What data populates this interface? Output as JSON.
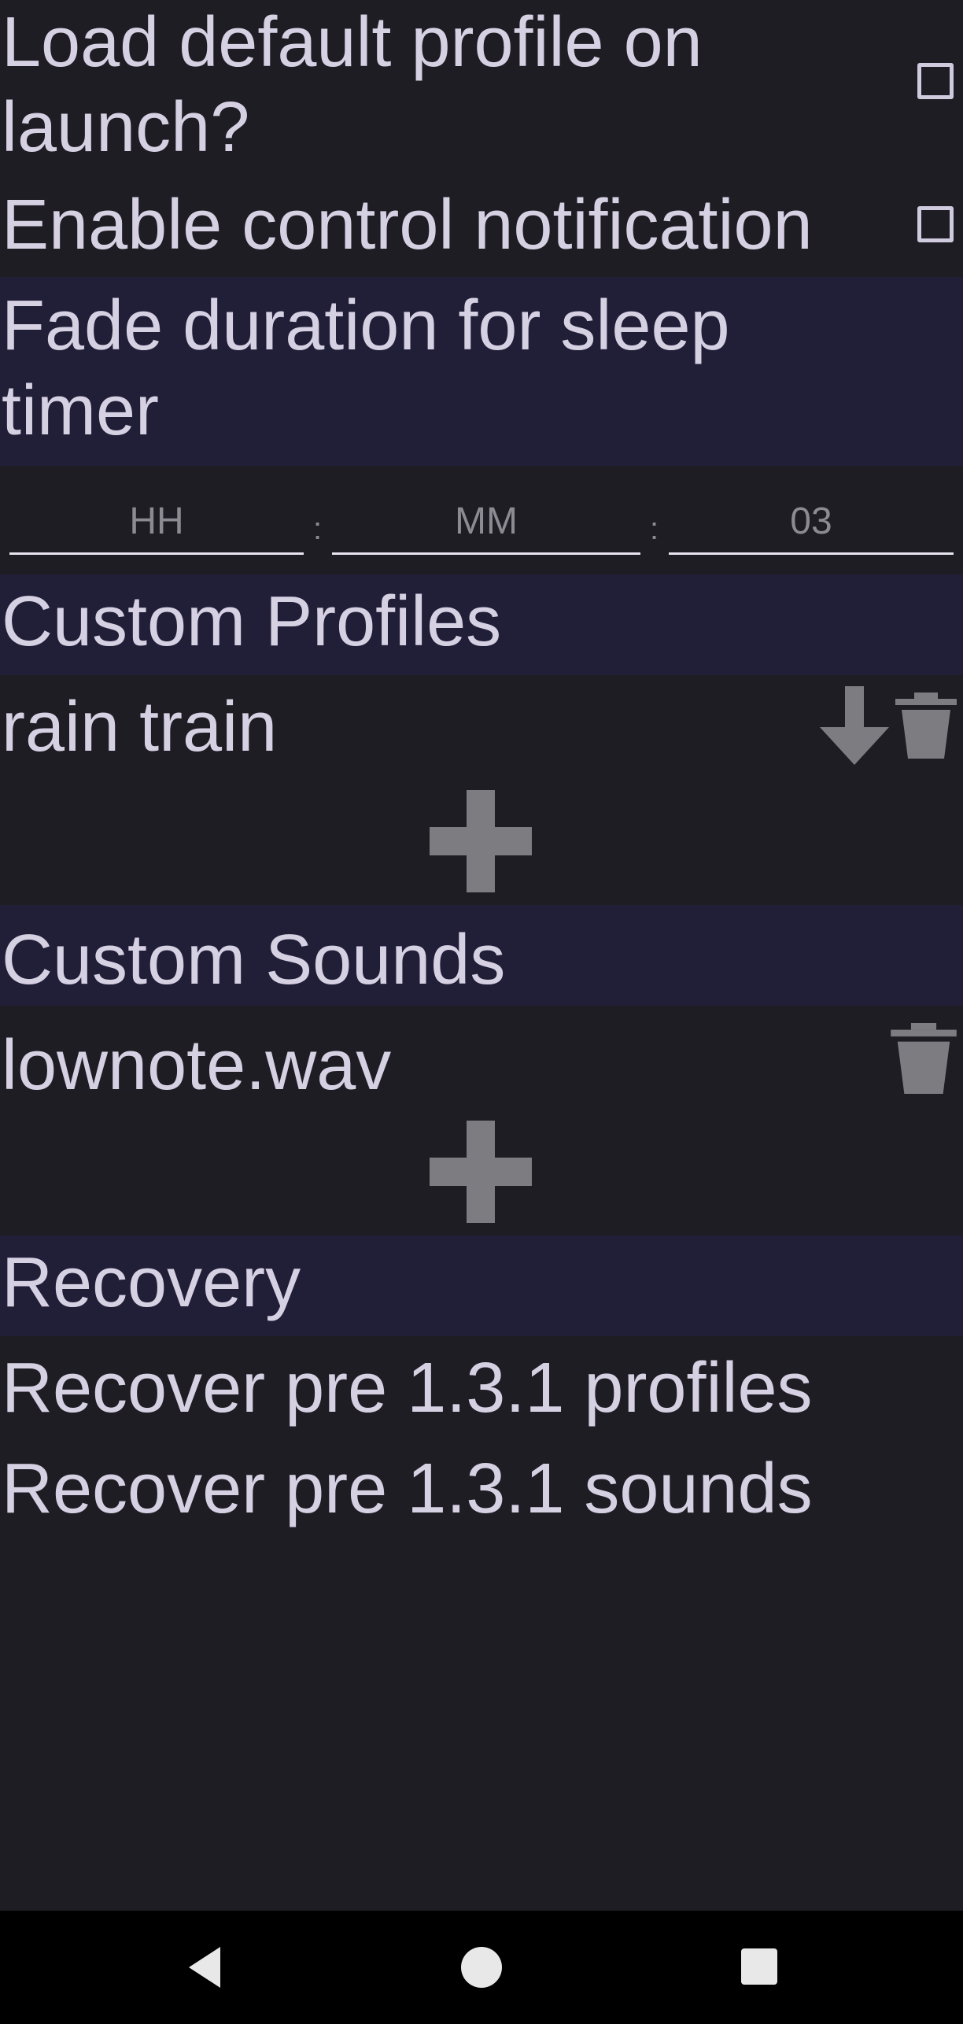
{
  "settings": {
    "load_default_label": "Load default profile on launch?",
    "control_notification_label": "Enable control notification"
  },
  "fade": {
    "header": "Fade duration for sleep timer",
    "hours_placeholder": "HH",
    "minutes_placeholder": "MM",
    "seconds_value": "03",
    "separator": ":"
  },
  "profiles": {
    "header": "Custom Profiles",
    "items": [
      {
        "name": "rain train"
      }
    ]
  },
  "sounds": {
    "header": "Custom Sounds",
    "items": [
      {
        "name": "lownote.wav"
      }
    ]
  },
  "recovery": {
    "header": "Recovery",
    "profiles_label": "Recover pre 1.3.1 profiles",
    "sounds_label": "Recover pre 1.3.1 sounds"
  },
  "icons": {
    "add": "plus-icon",
    "load": "download-arrow-icon",
    "delete": "trash-icon",
    "nav_back": "back-triangle-icon",
    "nav_home": "home-circle-icon",
    "nav_recents": "recents-square-icon"
  },
  "colors": {
    "background": "#1e1d23",
    "header_background": "#211f38",
    "text": "#d6d0e3",
    "icon_gray": "#7d7c81"
  }
}
